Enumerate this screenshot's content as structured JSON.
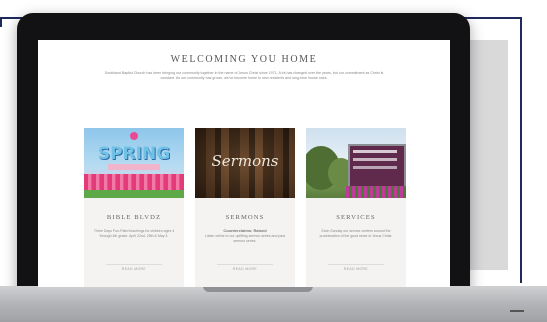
{
  "site": {
    "title": "WELCOMING YOU HOME",
    "intro": "Southland Baptist Church has been bringing our community together in the name of Jesus Christ since 1971. A lot has changed over the years, but our commitment as Christ is constant. As our community has grown, we've become home to new residents and long-time house ones."
  },
  "cards": [
    {
      "image_text": "SPRING",
      "heading": "BIBLE BLVDZ",
      "text": "Three Days Fun-Filled teachings for children ages 4 through 4th grade. April 22nd, 25th & May 3.",
      "more": "READ MORE"
    },
    {
      "image_text": "Sermons",
      "heading": "SERMONS",
      "strong": "Counterclaims: Raised",
      "text": "Listen online to our uplifting sermon series and past sermon series.",
      "more": "READ MORE"
    },
    {
      "image_text": "",
      "heading": "SERVICES",
      "text": "Each Sunday our service centers around the proclamation of the good news of Jesus Christ.",
      "more": "READ MORE"
    }
  ],
  "colors": {
    "frame": "#1f2a5c",
    "device": "#121214",
    "base": "#b4b6b9"
  }
}
